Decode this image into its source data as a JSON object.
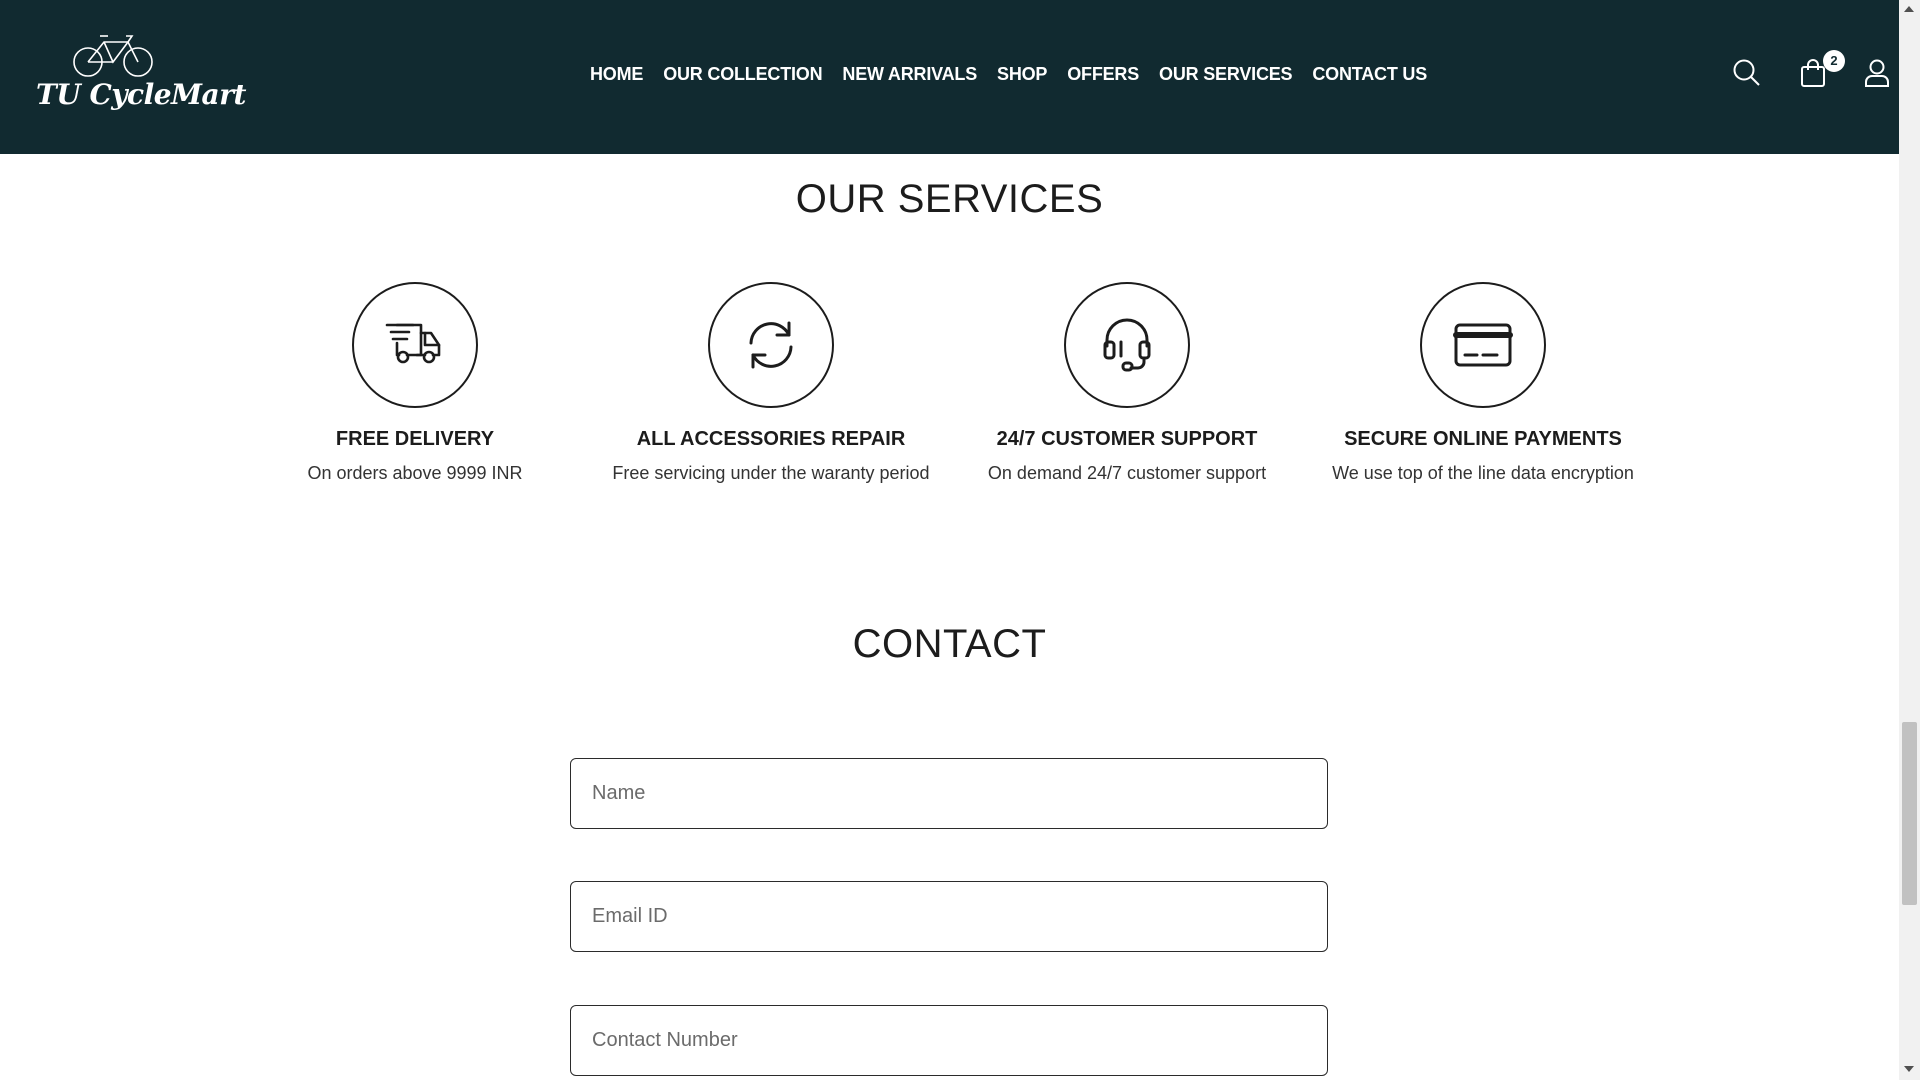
{
  "brand": {
    "logo_text": "TU CycleMart"
  },
  "nav": {
    "items": [
      "HOME",
      "OUR COLLECTION",
      "NEW ARRIVALS",
      "SHOP",
      "OFFERS",
      "OUR SERVICES",
      "CONTACT US"
    ]
  },
  "header_icons": {
    "search": "search-icon",
    "cart": "shopping-bag-icon",
    "account": "user-icon"
  },
  "cart": {
    "count": "2"
  },
  "services": {
    "title": "OUR SERVICES",
    "items": [
      {
        "icon": "delivery-truck-icon",
        "title": "FREE DELIVERY",
        "desc": "On orders above 9999 INR"
      },
      {
        "icon": "refresh-icon",
        "title": "ALL ACCESSORIES REPAIR",
        "desc": "Free servicing under the waranty period"
      },
      {
        "icon": "headset-icon",
        "title": "24/7 CUSTOMER SUPPORT",
        "desc": "On demand 24/7 customer support"
      },
      {
        "icon": "credit-card-icon",
        "title": "SECURE ONLINE PAYMENTS",
        "desc": "We use top of the line data encryption"
      }
    ]
  },
  "contact": {
    "title": "CONTACT",
    "fields": {
      "name_placeholder": "Name",
      "email_placeholder": "Email ID",
      "phone_placeholder": "Contact Number"
    }
  },
  "colors": {
    "header_bg": "#112a30",
    "text": "#1c1c1c",
    "white": "#ffffff"
  }
}
